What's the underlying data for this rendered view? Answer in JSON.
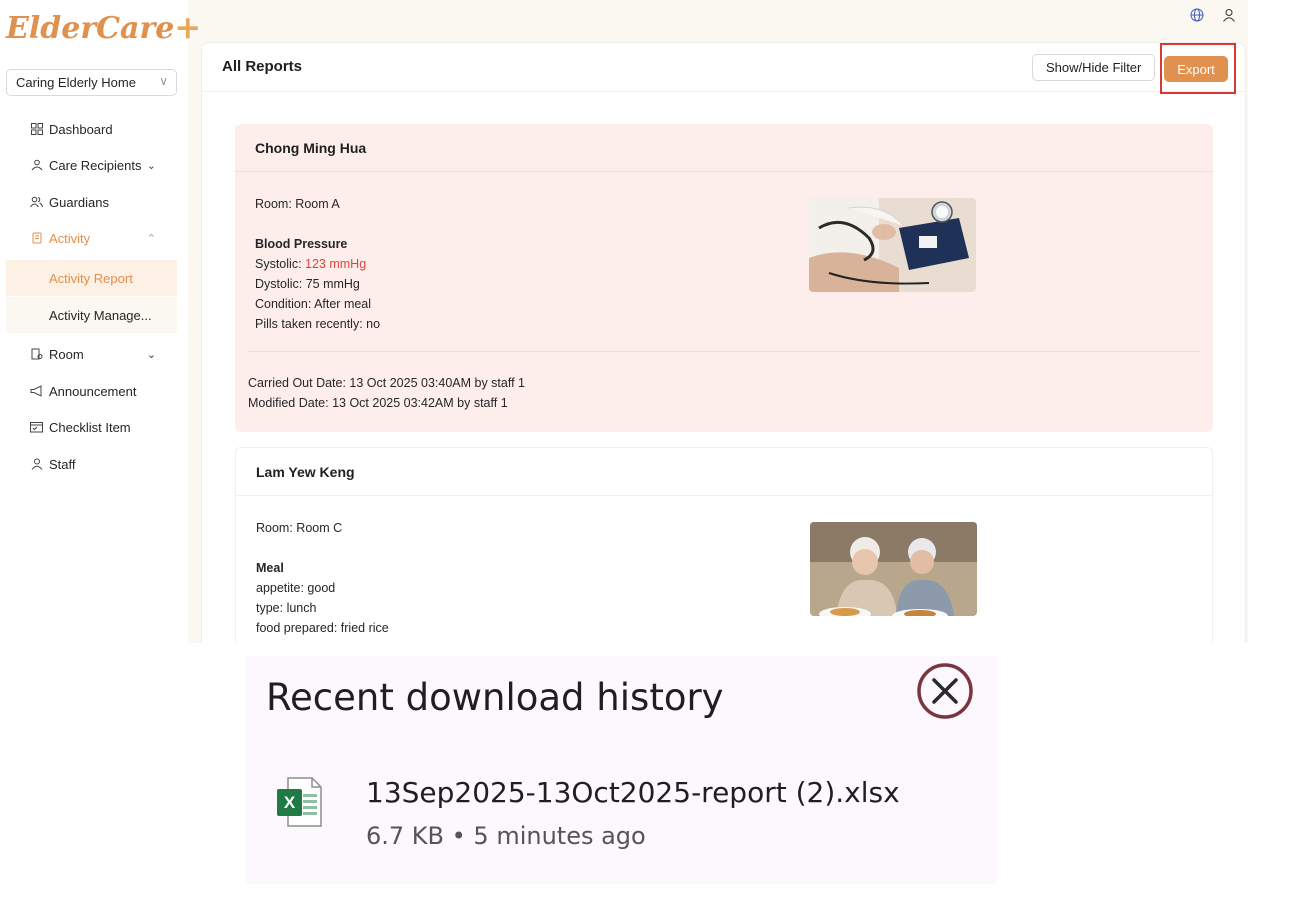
{
  "app": {
    "logo_text": "ElderCare",
    "logo_plus": "+",
    "home_selector": "Caring Elderly Home"
  },
  "sidebar": {
    "items": [
      {
        "label": "Dashboard",
        "icon": "dashboard-icon"
      },
      {
        "label": "Care Recipients",
        "icon": "care-recipients-icon"
      },
      {
        "label": "Guardians",
        "icon": "guardians-icon"
      },
      {
        "label": "Activity",
        "icon": "activity-icon"
      },
      {
        "label": "Room",
        "icon": "room-icon"
      },
      {
        "label": "Announcement",
        "icon": "announcement-icon"
      },
      {
        "label": "Checklist Item",
        "icon": "checklist-icon"
      },
      {
        "label": "Staff",
        "icon": "staff-icon"
      }
    ],
    "activity_sub": [
      {
        "label": "Activity Report"
      },
      {
        "label": "Activity Manage..."
      }
    ]
  },
  "header": {
    "title": "All Reports",
    "filter_label": "Show/Hide Filter",
    "export_label": "Export"
  },
  "reports": [
    {
      "name": "Chong Ming Hua",
      "room": "Room: Room A",
      "category": "Blood Pressure",
      "systolic_label": "Systolic: ",
      "systolic_value": "123 mmHg",
      "dystolic": "Dystolic: 75 mmHg",
      "condition": "Condition: After meal",
      "pills": "Pills taken recently: no",
      "carried_out": "Carried Out Date: 13 Oct 2025 03:40AM by staff 1",
      "modified": "Modified Date: 13 Oct 2025 03:42AM by staff 1"
    },
    {
      "name": "Lam Yew Keng",
      "room": "Room: Room C",
      "category": "Meal",
      "appetite": "appetite: good",
      "type": "type: lunch",
      "food": "food prepared: fried rice"
    }
  ],
  "download": {
    "title": "Recent download history",
    "file_name": "13Sep2025-13Oct2025-report (2).xlsx",
    "meta": "6.7 KB • 5 minutes ago"
  },
  "colors": {
    "accent": "#e0904f",
    "highlight_red": "#e0433a",
    "report_bg": "#fdeeec"
  }
}
